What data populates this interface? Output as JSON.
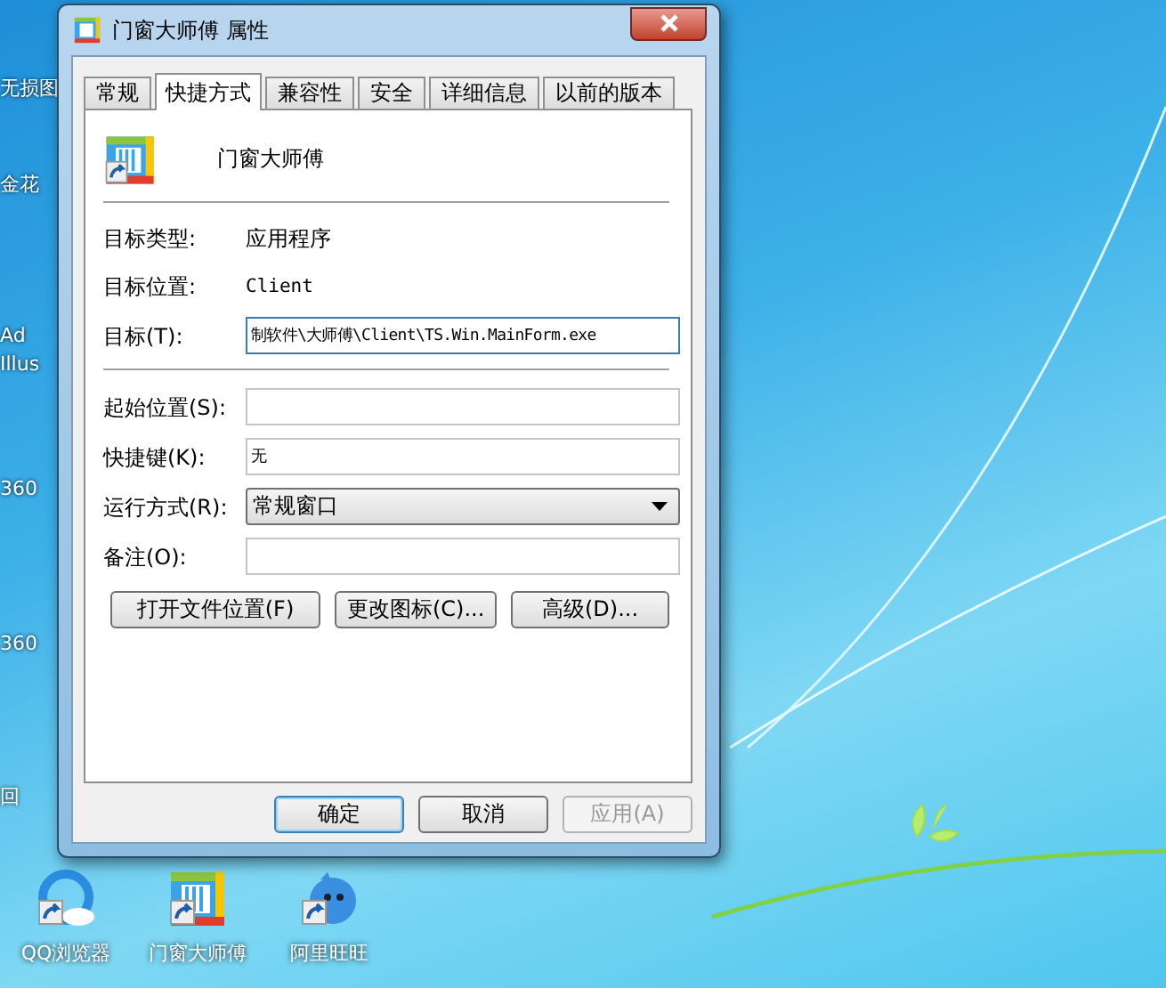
{
  "desktop_left_labels": [
    "无损图",
    "金花",
    "Ad",
    "Illus",
    "360",
    "360",
    "回"
  ],
  "desktop_icons": [
    {
      "label": "QQ浏览器",
      "kind": "browser"
    },
    {
      "label": "门窗大师傅",
      "kind": "app"
    },
    {
      "label": "阿里旺旺",
      "kind": "chat"
    }
  ],
  "window": {
    "title": "门窗大师傅 属性"
  },
  "tabs": [
    {
      "label": "常规",
      "selected": false
    },
    {
      "label": "快捷方式",
      "selected": true
    },
    {
      "label": "兼容性",
      "selected": false
    },
    {
      "label": "安全",
      "selected": false
    },
    {
      "label": "详细信息",
      "selected": false
    },
    {
      "label": "以前的版本",
      "selected": false
    }
  ],
  "app_name": "门窗大师傅",
  "sections": [
    [
      {
        "kind": "info",
        "label": "目标类型:",
        "value": "应用程序"
      },
      {
        "kind": "info",
        "label": "目标位置:",
        "value": "Client"
      },
      {
        "kind": "input",
        "label": "目标(T):",
        "value": "制软件\\大师傅\\Client\\TS.Win.MainForm.exe",
        "focused": true
      }
    ],
    [
      {
        "kind": "input",
        "label": "起始位置(S):",
        "focused": false
      },
      {
        "kind": "input",
        "label": "快捷键(K):",
        "value": "无",
        "focused": false
      },
      {
        "kind": "select",
        "label": "运行方式(R):",
        "value": "常规窗口"
      },
      {
        "kind": "input",
        "label": "备注(O):",
        "focused": false
      }
    ]
  ],
  "action_buttons": [
    "打开文件位置(F)",
    "更改图标(C)...",
    "高级(D)..."
  ],
  "footer_buttons": [
    {
      "label": "确定",
      "default": true,
      "disabled": false
    },
    {
      "label": "取消",
      "default": false,
      "disabled": false
    },
    {
      "label": "应用(A)",
      "default": false,
      "disabled": true
    }
  ]
}
